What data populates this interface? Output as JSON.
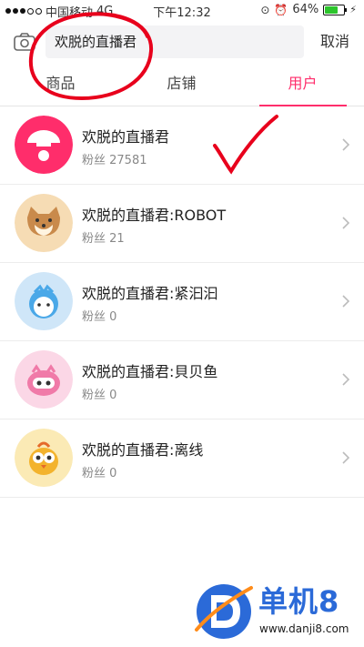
{
  "status": {
    "carrier": "中国移动",
    "network": "4G",
    "time": "下午12:32",
    "battery": "64%"
  },
  "search": {
    "query": "欢脱的直播君",
    "cancel_label": "取消"
  },
  "tabs": [
    {
      "label": "商品"
    },
    {
      "label": "店铺"
    },
    {
      "label": "用户"
    }
  ],
  "active_tab": "用户",
  "users": [
    {
      "name": "欢脱的直播君",
      "fans": "粉丝 27581"
    },
    {
      "name": "欢脱的直播君:ROBOT",
      "fans": "粉丝 21"
    },
    {
      "name": "欢脱的直播君:紧汩汩",
      "fans": "粉丝 0"
    },
    {
      "name": "欢脱的直播君:貝贝鱼",
      "fans": "粉丝 0"
    },
    {
      "name": "欢脱的直播君:离线",
      "fans": "粉丝 0"
    }
  ],
  "watermark": {
    "brand": "单机8",
    "url": "www.danji8.com"
  },
  "colors": {
    "accent": "#ff2d6b",
    "annotation": "#e8001c",
    "brand_blue": "#2b6ad8"
  }
}
